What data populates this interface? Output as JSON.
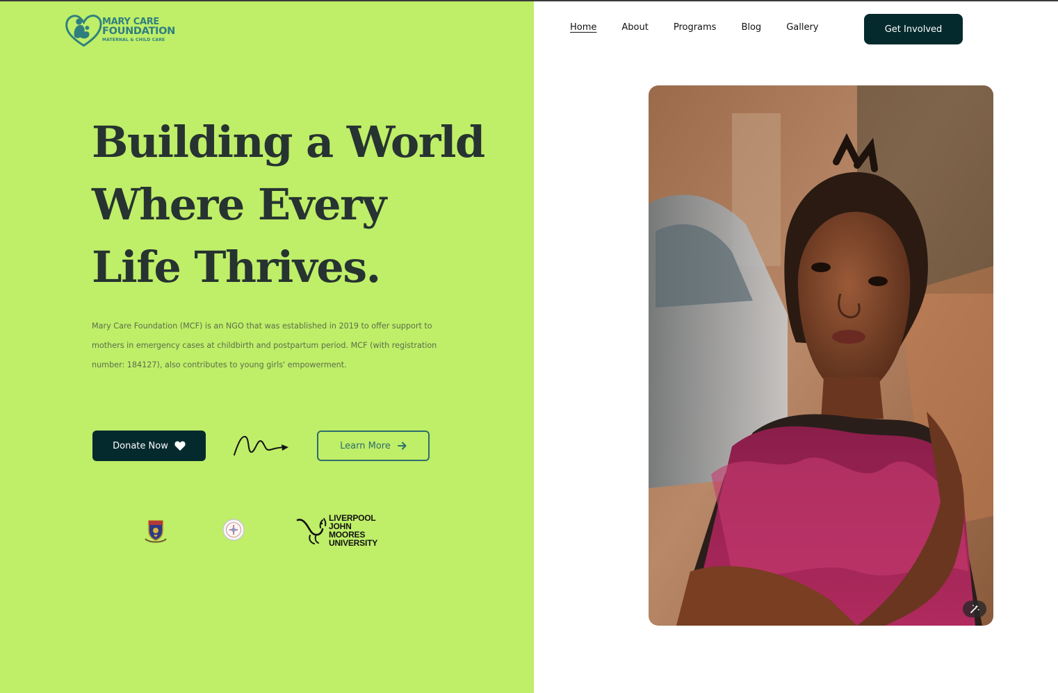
{
  "logo": {
    "line1": "MARY CARE",
    "line2": "FOUNDATION",
    "tagline": "MATERNAL & CHILD CARE",
    "icon": "mother-child-heart-logo"
  },
  "nav": {
    "items": [
      {
        "label": "Home",
        "active": true
      },
      {
        "label": "About"
      },
      {
        "label": "Programs"
      },
      {
        "label": "Blog"
      },
      {
        "label": "Gallery"
      }
    ],
    "cta": "Get Involved"
  },
  "hero": {
    "title_lines": [
      "Building a World",
      "Where Every",
      "Life Thrives."
    ],
    "description": "Mary Care Foundation (MCF) is an NGO that was established in 2019 to offer support to mothers in emergency cases at childbirth and postpartum period. MCF (with registration number: 184127), also contributes to young girls' empowerment.",
    "donate_label": "Donate Now",
    "donate_icon": "heart-icon",
    "learn_label": "Learn More",
    "learn_icon": "arrow-right-icon",
    "decoration_icon": "squiggle-arrow-icon"
  },
  "partners": [
    {
      "name": "crest-logo",
      "icon": "university-crest-icon"
    },
    {
      "name": "seal-logo",
      "icon": "round-seal-icon"
    },
    {
      "name": "ljmu-logo",
      "icon": "liver-bird-icon",
      "lines": [
        "LIVERPOOL",
        "JOHN MOORES",
        "UNIVERSITY"
      ]
    }
  ],
  "photo": {
    "subject": "portrait of a young girl in a magenta tulle dress",
    "edit_icon": "magic-wand-icon"
  },
  "colors": {
    "accent_green": "#bfee68",
    "dark_teal": "#052a2e",
    "heading": "#263331",
    "logo_teal": "#2f7f7f",
    "outline_teal": "#2c6d6b"
  }
}
